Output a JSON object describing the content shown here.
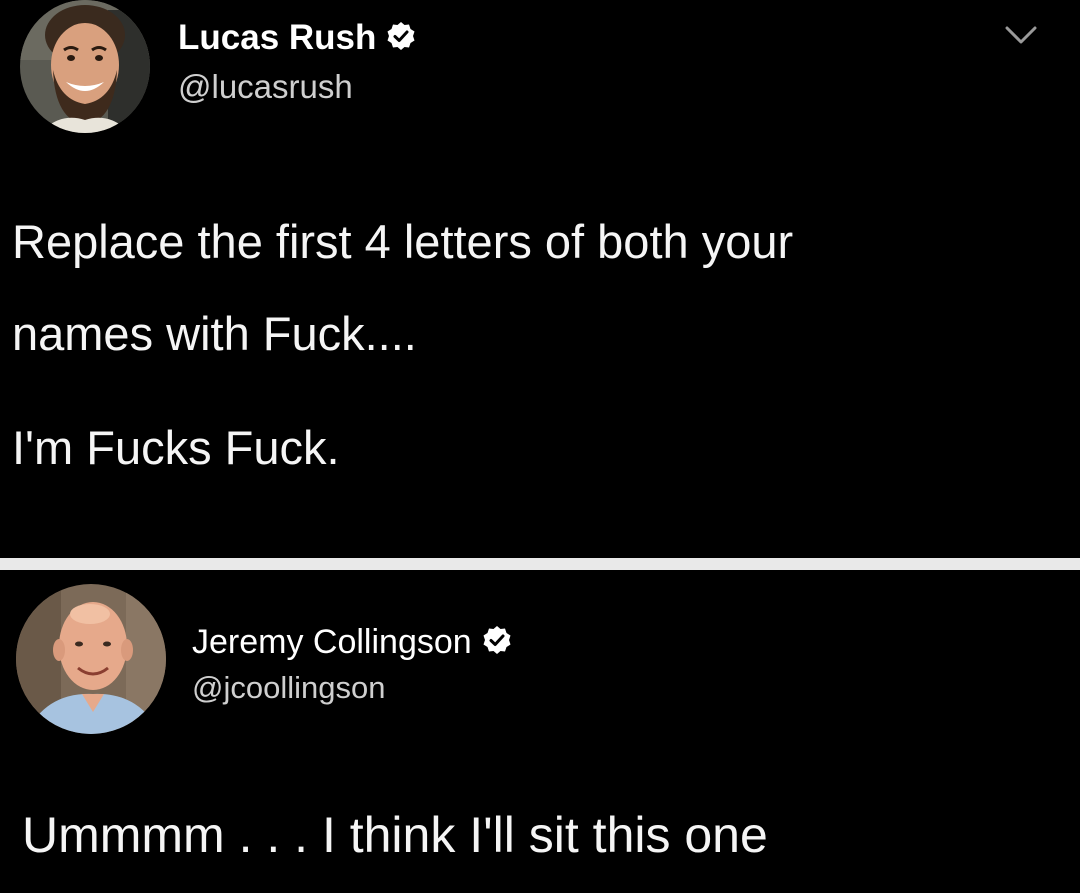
{
  "tweets": [
    {
      "display_name": "Lucas Rush",
      "handle": "@lucasrush",
      "verified": true,
      "lines": [
        "Replace the first 4 letters of both your",
        "names with Fuck....",
        "I'm Fucks Fuck."
      ],
      "icons": {
        "verified": "verified-badge-icon",
        "more": "chevron-down-icon"
      }
    },
    {
      "display_name": "Jeremy Collingson",
      "handle": "@jcoollingson",
      "verified": true,
      "lines": [
        "Ummmm . . . I think I'll sit this one"
      ],
      "icons": {
        "verified": "verified-badge-icon"
      }
    }
  ],
  "colors": {
    "background": "#000000",
    "divider": "#e9e9e9",
    "text": "#f5f5f5",
    "handle": "#cfcfcf"
  }
}
